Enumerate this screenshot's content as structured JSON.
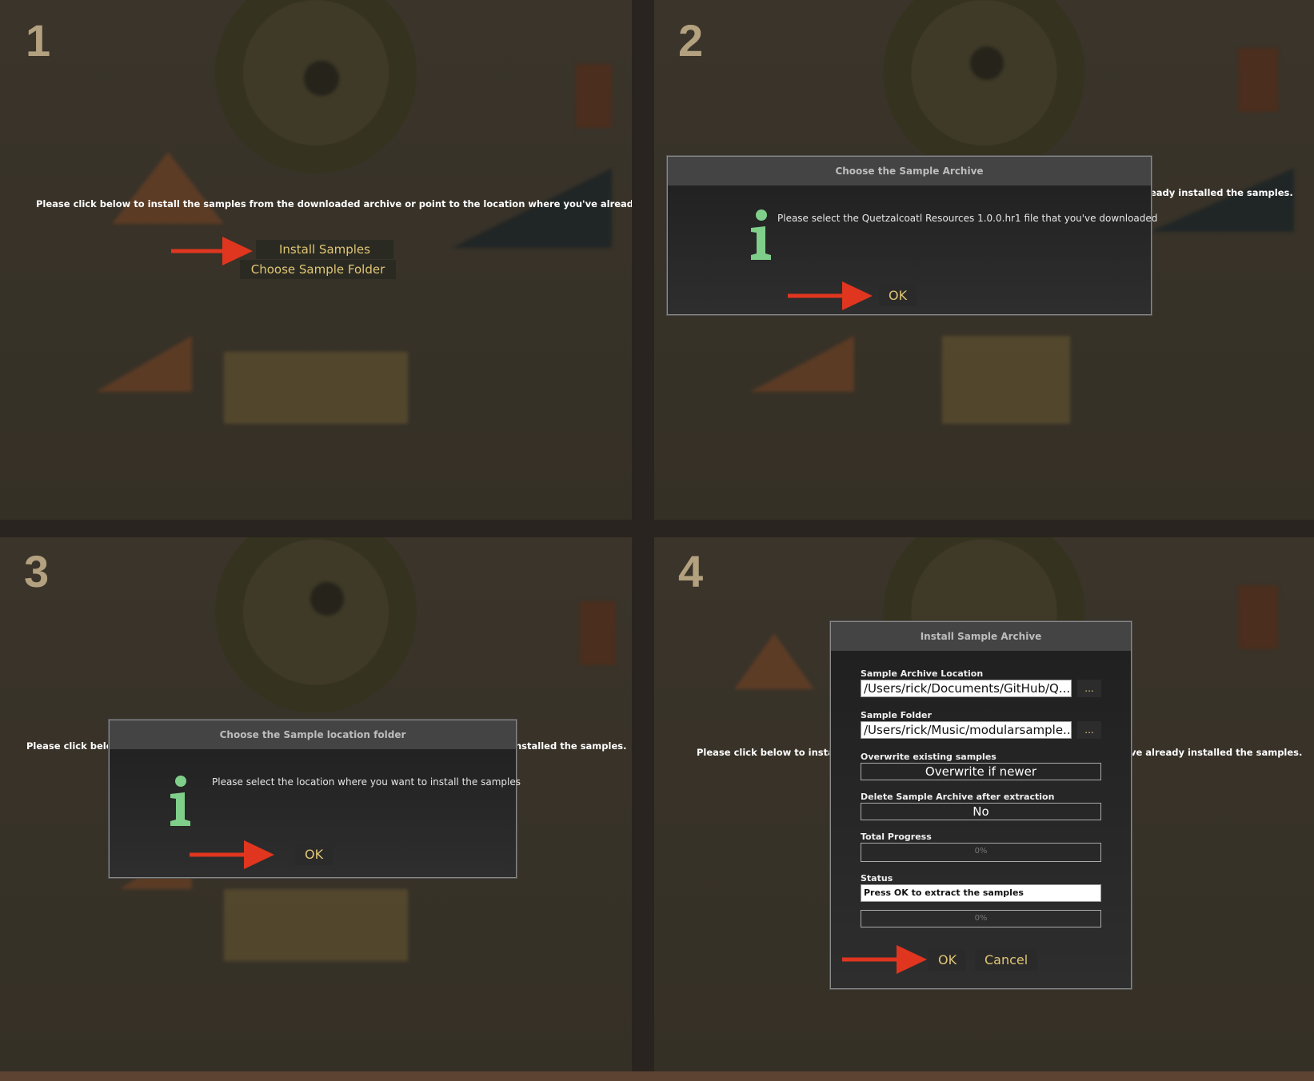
{
  "steps": [
    {
      "number": "1",
      "prompt": "Please click below to install the samples from the downloaded archive or point to the location where you've already installed the samples.",
      "install_button": "Install Samples",
      "folder_button": "Choose Sample Folder"
    },
    {
      "number": "2",
      "prompt_partial": "eady installed the samples.",
      "dialog": {
        "title": "Choose the Sample Archive",
        "message": "Please select the Quetzalcoatl Resources 1.0.0.hr1 file that you've downloaded",
        "ok": "OK"
      }
    },
    {
      "number": "3",
      "prompt_left": "Please click below t",
      "prompt_right": "nstalled the samples.",
      "dialog": {
        "title": "Choose the Sample location folder",
        "message": "Please select the location where you want to install the samples",
        "ok": "OK"
      }
    },
    {
      "number": "4",
      "prompt_left": "Please click below to install the s",
      "prompt_right": "ve already installed the samples.",
      "dialog": {
        "title": "Install Sample Archive",
        "archive_label": "Sample Archive Location",
        "archive_value": "/Users/rick/Documents/GitHub/Q...",
        "folder_label": "Sample Folder",
        "folder_value": "/Users/rick/Music/modularsample...",
        "browse": "...",
        "overwrite_label": "Overwrite existing samples",
        "overwrite_value": "Overwrite if newer",
        "delete_label": "Delete Sample Archive after extraction",
        "delete_value": "No",
        "total_label": "Total Progress",
        "total_value": "0%",
        "status_label": "Status",
        "status_value": "Press OK to extract the samples",
        "status_progress": "0%",
        "ok": "OK",
        "cancel": "Cancel"
      }
    }
  ],
  "colors": {
    "accent_text": "#e0c675",
    "arrow": "#e0361f",
    "info_icon": "#7fcf8a"
  }
}
